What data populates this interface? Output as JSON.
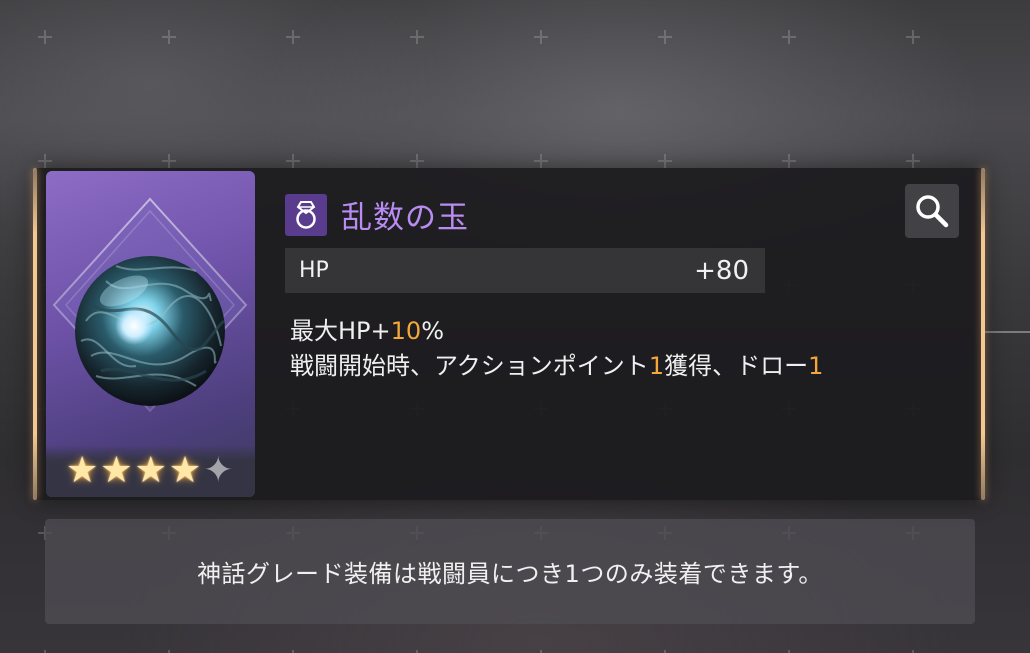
{
  "item": {
    "name": "乱数の玉",
    "type_icon": "ring-icon",
    "rarity_stars_filled": 4,
    "rarity_stars_total": 5,
    "art": "dark-tangled-orb",
    "colors": {
      "name": "#b98cf2",
      "highlight": "#f4a83a",
      "frame_glow": "#f3c893",
      "art_bg": "#7a5cb6"
    }
  },
  "stats": [
    {
      "label": "HP",
      "value": "+80"
    }
  ],
  "description": {
    "line1": {
      "before": "最大HP+",
      "highlight": "10",
      "after": "%"
    },
    "line2": {
      "part1": "戦闘開始時、アクションポイント",
      "hl1": "1",
      "part2": "獲得、ドロー",
      "hl2": "1"
    }
  },
  "actions": {
    "zoom_icon": "search-icon"
  },
  "notice": {
    "text": "神話グレード装備は戦闘員につき1つのみ装着できます。"
  }
}
